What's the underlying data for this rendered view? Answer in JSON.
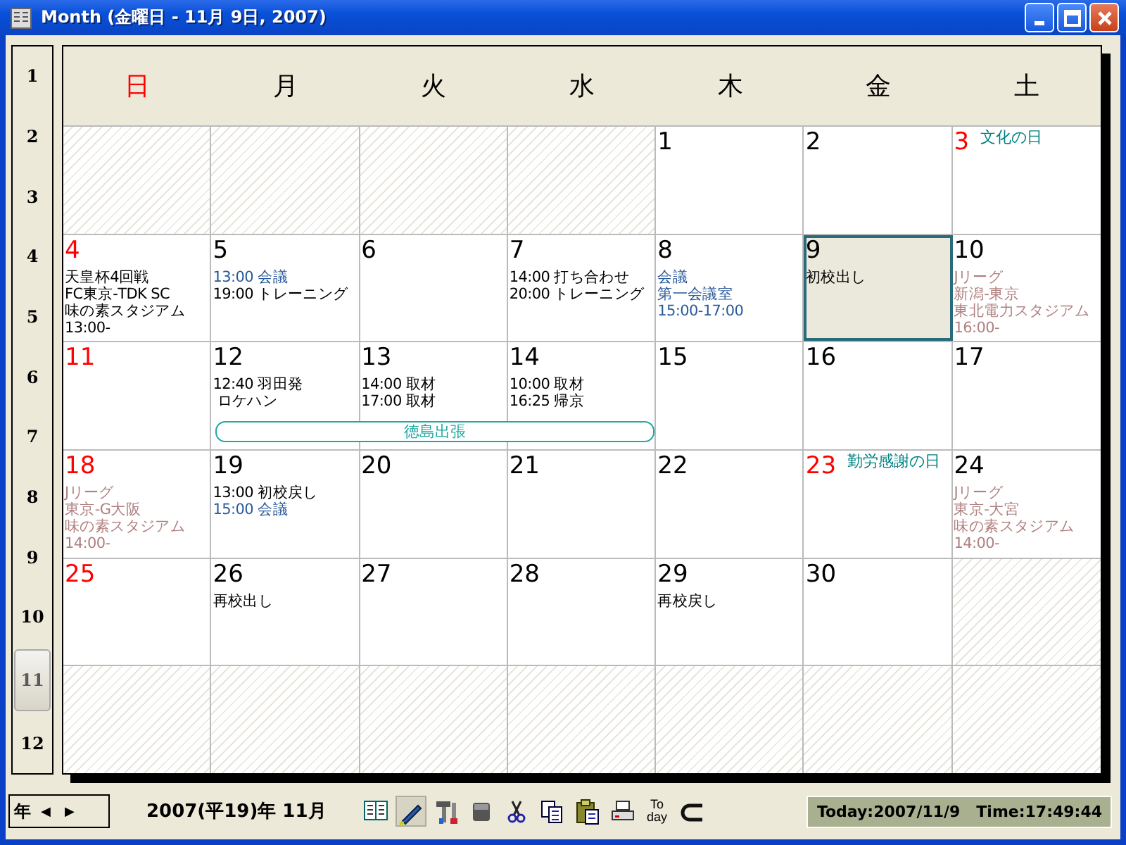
{
  "window": {
    "title": "Month (金曜日 - 11月 9日, 2007)"
  },
  "months": [
    {
      "label": "1",
      "selected": false
    },
    {
      "label": "2",
      "selected": false
    },
    {
      "label": "3",
      "selected": false
    },
    {
      "label": "4",
      "selected": false
    },
    {
      "label": "5",
      "selected": false
    },
    {
      "label": "6",
      "selected": false
    },
    {
      "label": "7",
      "selected": false
    },
    {
      "label": "8",
      "selected": false
    },
    {
      "label": "9",
      "selected": false
    },
    {
      "label": "10",
      "selected": false
    },
    {
      "label": "11",
      "selected": true
    },
    {
      "label": "12",
      "selected": false
    }
  ],
  "weekdays": [
    {
      "label": "日",
      "holiday": true
    },
    {
      "label": "月",
      "holiday": false
    },
    {
      "label": "火",
      "holiday": false
    },
    {
      "label": "水",
      "holiday": false
    },
    {
      "label": "木",
      "holiday": false
    },
    {
      "label": "金",
      "holiday": false
    },
    {
      "label": "土",
      "holiday": false
    }
  ],
  "weeks": [
    {
      "days": [
        {
          "kind": "blank"
        },
        {
          "kind": "blank"
        },
        {
          "kind": "blank"
        },
        {
          "kind": "blank"
        },
        {
          "kind": "day",
          "date": "1",
          "holiday": false,
          "selected": false
        },
        {
          "kind": "day",
          "date": "2",
          "holiday": false,
          "selected": false
        },
        {
          "kind": "day",
          "date": "3",
          "holiday": true,
          "selected": false,
          "holiday_name": "文化の日"
        }
      ]
    },
    {
      "days": [
        {
          "kind": "day",
          "date": "4",
          "holiday": true,
          "selected": false,
          "events": [
            {
              "kind": "plain",
              "lines": [
                "天皇杯4回戦",
                "FC東京-TDK SC",
                "味の素スタジアム",
                "13:00-"
              ]
            }
          ]
        },
        {
          "kind": "day",
          "date": "5",
          "holiday": false,
          "selected": false,
          "events": [
            {
              "kind": "meeting",
              "lines": [
                "13:00 会議"
              ]
            },
            {
              "kind": "plain",
              "lines": [
                "19:00 トレーニング"
              ]
            }
          ]
        },
        {
          "kind": "day",
          "date": "6",
          "holiday": false,
          "selected": false
        },
        {
          "kind": "day",
          "date": "7",
          "holiday": false,
          "selected": false,
          "events": [
            {
              "kind": "plain",
              "lines": [
                "14:00 打ち合わせ",
                "20:00 トレーニング"
              ]
            }
          ]
        },
        {
          "kind": "day",
          "date": "8",
          "holiday": false,
          "selected": false,
          "events": [
            {
              "kind": "meeting",
              "lines": [
                "会議"
              ]
            },
            {
              "kind": "meeting",
              "lines": [
                "第一会議室",
                "15:00-17:00"
              ]
            }
          ]
        },
        {
          "kind": "day",
          "date": "9",
          "holiday": false,
          "selected": true,
          "events": [
            {
              "kind": "plain",
              "lines": [
                "初校出し"
              ]
            }
          ]
        },
        {
          "kind": "day",
          "date": "10",
          "holiday": false,
          "selected": false,
          "events": [
            {
              "kind": "sports",
              "lines": [
                "Jリーグ",
                "新潟-東京",
                "東北電力スタジアム",
                "16:00-"
              ]
            }
          ]
        }
      ]
    },
    {
      "days": [
        {
          "kind": "day",
          "date": "11",
          "holiday": true,
          "selected": false
        },
        {
          "kind": "day",
          "date": "12",
          "holiday": false,
          "selected": false,
          "events": [
            {
              "kind": "plain",
              "lines": [
                "12:40 羽田発",
                " ロケハン"
              ]
            }
          ],
          "banner": "徳島出張"
        },
        {
          "kind": "day",
          "date": "13",
          "holiday": false,
          "selected": false,
          "events": [
            {
              "kind": "plain",
              "lines": [
                "14:00 取材",
                "17:00 取材"
              ]
            }
          ],
          "banner_continues": true
        },
        {
          "kind": "day",
          "date": "14",
          "holiday": false,
          "selected": false,
          "events": [
            {
              "kind": "plain",
              "lines": [
                "10:00 取材",
                "16:25 帰京"
              ]
            }
          ],
          "banner_continues": true
        },
        {
          "kind": "day",
          "date": "15",
          "holiday": false,
          "selected": false
        },
        {
          "kind": "day",
          "date": "16",
          "holiday": false,
          "selected": false
        },
        {
          "kind": "day",
          "date": "17",
          "holiday": false,
          "selected": false
        }
      ]
    },
    {
      "days": [
        {
          "kind": "day",
          "date": "18",
          "holiday": true,
          "selected": false,
          "events": [
            {
              "kind": "sports",
              "lines": [
                "Jリーグ",
                "東京-G大阪",
                "味の素スタジアム",
                "14:00-"
              ]
            }
          ]
        },
        {
          "kind": "day",
          "date": "19",
          "holiday": false,
          "selected": false,
          "events": [
            {
              "kind": "plain",
              "lines": [
                "13:00 初校戻し"
              ]
            },
            {
              "kind": "meeting",
              "lines": [
                "15:00 会議"
              ]
            }
          ]
        },
        {
          "kind": "day",
          "date": "20",
          "holiday": false,
          "selected": false
        },
        {
          "kind": "day",
          "date": "21",
          "holiday": false,
          "selected": false
        },
        {
          "kind": "day",
          "date": "22",
          "holiday": false,
          "selected": false
        },
        {
          "kind": "day",
          "date": "23",
          "holiday": true,
          "selected": false,
          "holiday_name": "勤労感謝の日"
        },
        {
          "kind": "day",
          "date": "24",
          "holiday": false,
          "selected": false,
          "events": [
            {
              "kind": "sports",
              "lines": [
                "Jリーグ",
                "東京-大宮",
                "味の素スタジアム",
                "14:00-"
              ]
            }
          ]
        }
      ]
    },
    {
      "days": [
        {
          "kind": "day",
          "date": "25",
          "holiday": true,
          "selected": false
        },
        {
          "kind": "day",
          "date": "26",
          "holiday": false,
          "selected": false,
          "events": [
            {
              "kind": "plain",
              "lines": [
                "再校出し"
              ]
            }
          ]
        },
        {
          "kind": "day",
          "date": "27",
          "holiday": false,
          "selected": false
        },
        {
          "kind": "day",
          "date": "28",
          "holiday": false,
          "selected": false
        },
        {
          "kind": "day",
          "date": "29",
          "holiday": false,
          "selected": false,
          "events": [
            {
              "kind": "plain",
              "lines": [
                "再校戻し"
              ]
            }
          ]
        },
        {
          "kind": "day",
          "date": "30",
          "holiday": false,
          "selected": false
        },
        {
          "kind": "blank"
        }
      ]
    },
    {
      "days": [
        {
          "kind": "blank"
        },
        {
          "kind": "blank"
        },
        {
          "kind": "blank"
        },
        {
          "kind": "blank"
        },
        {
          "kind": "blank"
        },
        {
          "kind": "blank"
        },
        {
          "kind": "blank"
        }
      ]
    }
  ],
  "footer": {
    "year_label": "年",
    "prev": "◀",
    "next": "▶",
    "current_month": "2007(平19)年 11月",
    "tools": [
      {
        "kind": "book",
        "pressed": false
      },
      {
        "kind": "edit",
        "pressed": true
      },
      {
        "kind": "tools",
        "pressed": false
      },
      {
        "kind": "block",
        "pressed": false
      },
      {
        "kind": "cut",
        "pressed": false
      },
      {
        "kind": "copy",
        "pressed": false
      },
      {
        "kind": "paste",
        "pressed": false
      },
      {
        "kind": "print",
        "pressed": false
      },
      {
        "kind": "today",
        "pressed": false,
        "lines": [
          "To",
          "day"
        ]
      },
      {
        "kind": "undo",
        "pressed": false
      }
    ],
    "status": "Today:2007/11/9   Time:17:49:44"
  }
}
